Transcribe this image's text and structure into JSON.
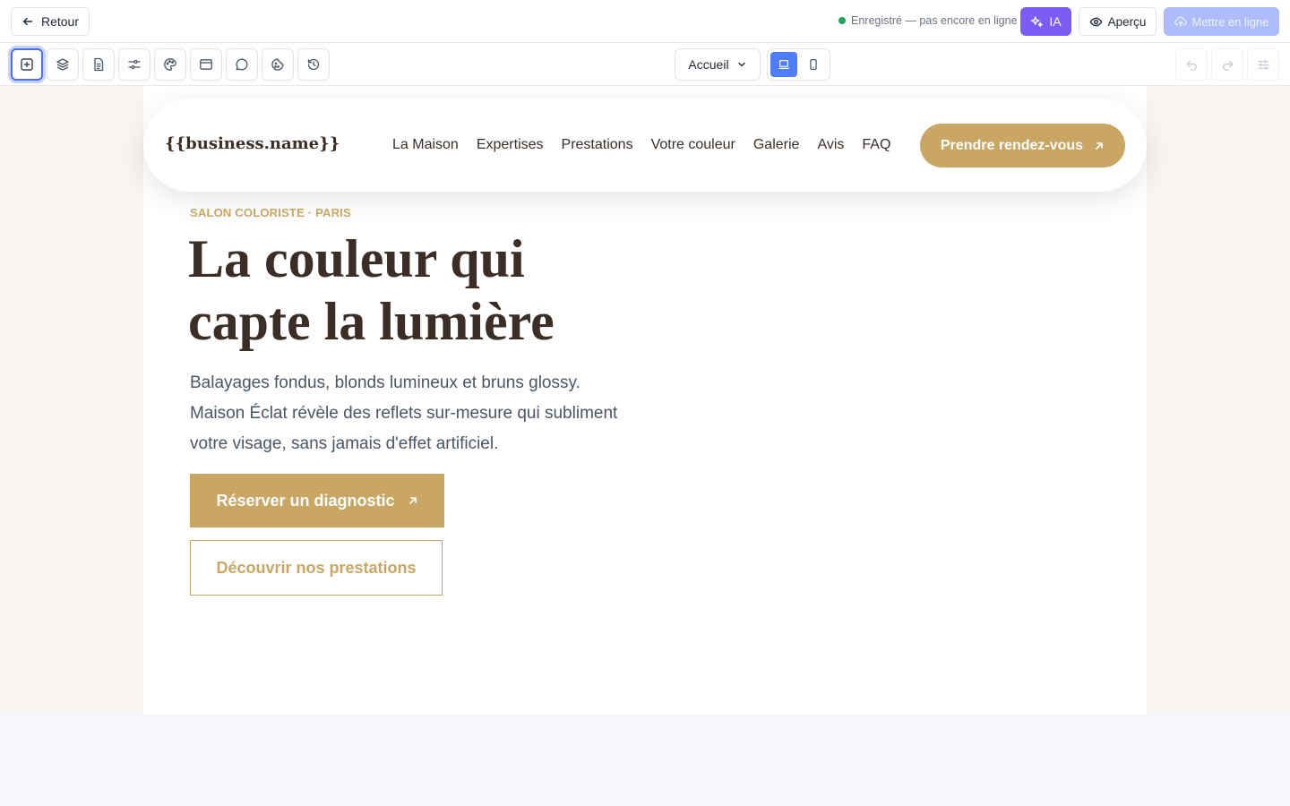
{
  "colors": {
    "accent": "#c9a664",
    "text_dark": "#3b2e27",
    "status_green": "#22a55b",
    "ai_purple": "#7b5cf5",
    "publish_disabled": "#aebcfb",
    "canvas_bg": "#f8f4ef"
  },
  "topbar": {
    "back_label": "Retour",
    "status_text": "Enregistré — pas encore en ligne",
    "ai_label": "IA",
    "preview_label": "Aperçu",
    "publish_label": "Mettre en ligne"
  },
  "toolbar": {
    "tools": [
      "add-section-icon",
      "layers-icon",
      "page-icon",
      "settings-sliders-icon",
      "palette-icon",
      "browser-window-icon",
      "chat-icon",
      "cookie-icon",
      "history-icon"
    ],
    "page_select": "Accueil",
    "devices": [
      "desktop-icon",
      "mobile-icon"
    ],
    "right_tools": [
      "undo-icon",
      "redo-icon",
      "adjustments-icon"
    ]
  },
  "site": {
    "brand": "{{business.name}}",
    "nav": [
      "La Maison",
      "Expertises",
      "Prestations",
      "Votre couleur",
      "Galerie",
      "Avis",
      "FAQ"
    ],
    "nav_cta": "Prendre rendez-vous",
    "eyebrow": "SALON COLORISTE · PARIS",
    "headline": "La couleur qui capte la lumière",
    "lead": "Balayages fondus, blonds lumineux et bruns glossy. Maison Éclat révèle des reflets sur-mesure qui subliment votre visage, sans jamais d'effet artificiel.",
    "primary_cta": "Réserver un diagnostic",
    "secondary_cta": "Découvrir nos prestations"
  }
}
